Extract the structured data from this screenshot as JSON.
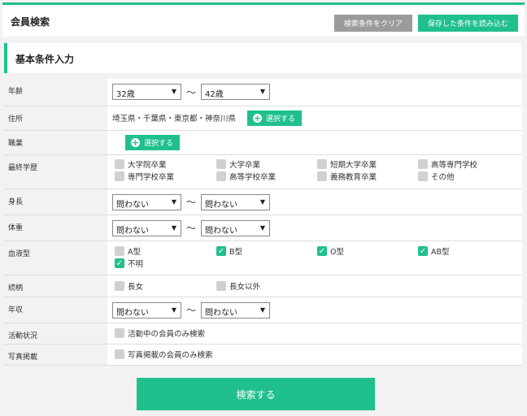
{
  "header": {
    "title": "会員検索",
    "clear_label": "検索条件をクリア",
    "load_label": "保存した条件を読み込む"
  },
  "section": {
    "title": "基本条件入力"
  },
  "fields": {
    "age": {
      "label": "年齢",
      "from": "32歳",
      "to": "42歳"
    },
    "address": {
      "label": "住所",
      "value": "埼玉県・千葉県・東京都・神奈川県",
      "button": "選択する"
    },
    "occupation": {
      "label": "職業",
      "button": "選択する"
    },
    "education": {
      "label": "最終学歴",
      "options": [
        {
          "label": "大学院卒業",
          "checked": false
        },
        {
          "label": "大学卒業",
          "checked": false
        },
        {
          "label": "短期大学卒業",
          "checked": false
        },
        {
          "label": "高等専門学校",
          "checked": false
        },
        {
          "label": "専門学校卒業",
          "checked": false
        },
        {
          "label": "高等学校卒業",
          "checked": false
        },
        {
          "label": "義務教育卒業",
          "checked": false
        },
        {
          "label": "その他",
          "checked": false
        }
      ]
    },
    "height": {
      "label": "身長",
      "from": "問わない",
      "to": "問わない"
    },
    "weight": {
      "label": "体重",
      "from": "問わない",
      "to": "問わない"
    },
    "blood": {
      "label": "血液型",
      "options": [
        {
          "label": "A型",
          "checked": false
        },
        {
          "label": "B型",
          "checked": true
        },
        {
          "label": "O型",
          "checked": true
        },
        {
          "label": "AB型",
          "checked": true
        },
        {
          "label": "不明",
          "checked": true
        }
      ]
    },
    "sibling": {
      "label": "続柄",
      "options": [
        {
          "label": "長女",
          "checked": false
        },
        {
          "label": "長女以外",
          "checked": false
        }
      ]
    },
    "income": {
      "label": "年収",
      "from": "問わない",
      "to": "問わない"
    },
    "activity": {
      "label": "活動状況",
      "option": "活動中の会員のみ検索",
      "checked": false
    },
    "photo": {
      "label": "写真掲載",
      "option": "写真掲載の会員のみ検索",
      "checked": false
    }
  },
  "tilde": "〜",
  "search_label": "検索する",
  "colors": {
    "accent": "#1fc08e",
    "gray_button": "#9b9b9b"
  },
  "icons": {
    "dropdown": "chevron-down-icon",
    "plus": "plus-circle-icon",
    "check": "check-icon"
  }
}
